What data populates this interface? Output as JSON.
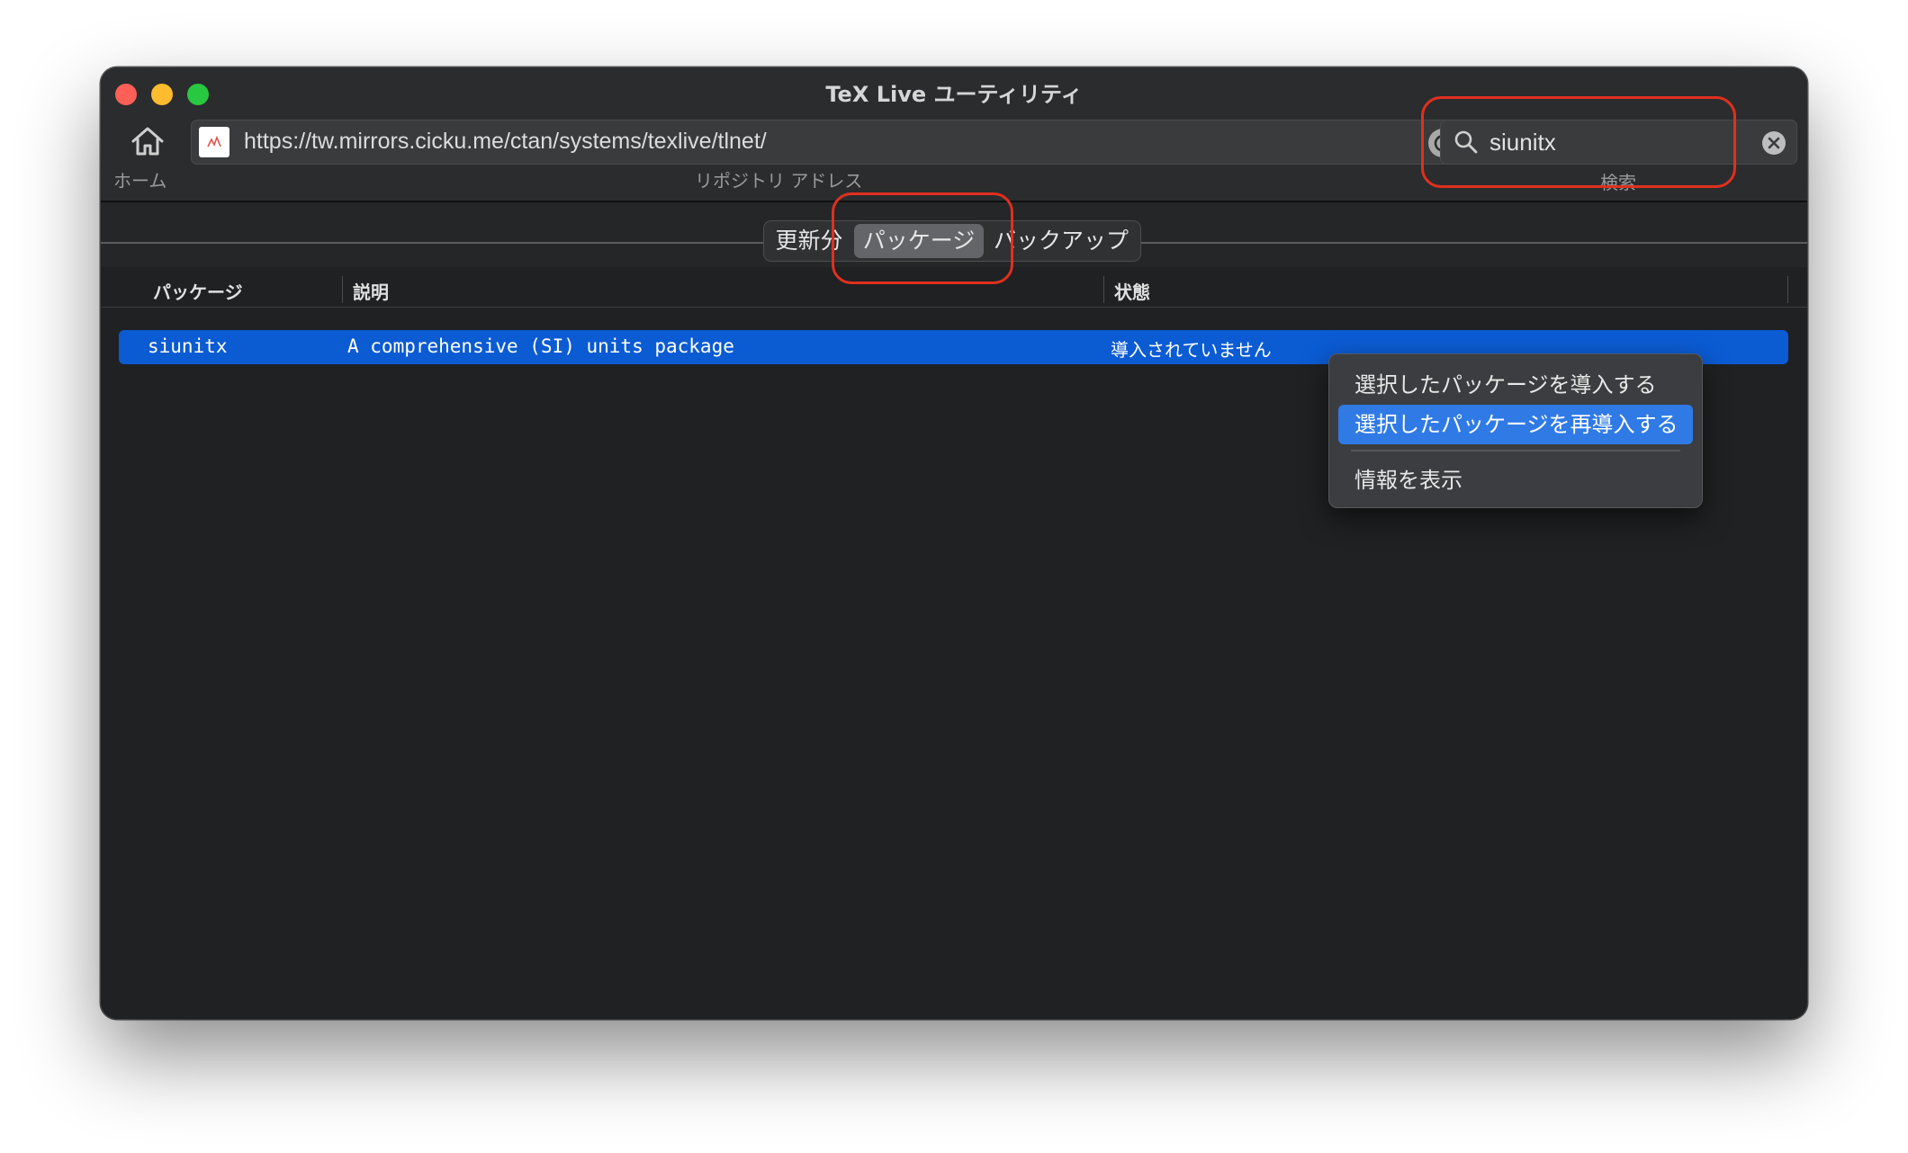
{
  "window": {
    "title": "TeX Live ユーティリティ"
  },
  "toolbar": {
    "home_label": "ホーム",
    "address_label": "リポジトリ アドレス",
    "address_url": "https://tw.mirrors.cicku.me/ctan/systems/texlive/tlnet/",
    "search_value": "siunitx",
    "search_label": "検索"
  },
  "tabs": [
    {
      "label": "更新分",
      "selected": false
    },
    {
      "label": "パッケージ",
      "selected": true
    },
    {
      "label": "バックアップ",
      "selected": false
    }
  ],
  "table": {
    "columns": [
      "パッケージ",
      "説明",
      "状態"
    ],
    "rows": [
      {
        "package": "siunitx",
        "description": "A comprehensive (SI) units package",
        "status": "導入されていません",
        "selected": true
      }
    ]
  },
  "context_menu": {
    "items": [
      {
        "label": "選択したパッケージを導入する",
        "highlighted": false
      },
      {
        "label": "選択したパッケージを再導入する",
        "highlighted": true
      },
      {
        "label": "情報を表示",
        "highlighted": false
      }
    ]
  },
  "colors": {
    "selection_blue": "#0b5bd3",
    "menu_highlight": "#2f7ae5",
    "annotation_red": "#e0301e"
  },
  "icons": [
    "home-icon",
    "favicon-icon",
    "reload-icon",
    "search-icon",
    "clear-icon"
  ]
}
